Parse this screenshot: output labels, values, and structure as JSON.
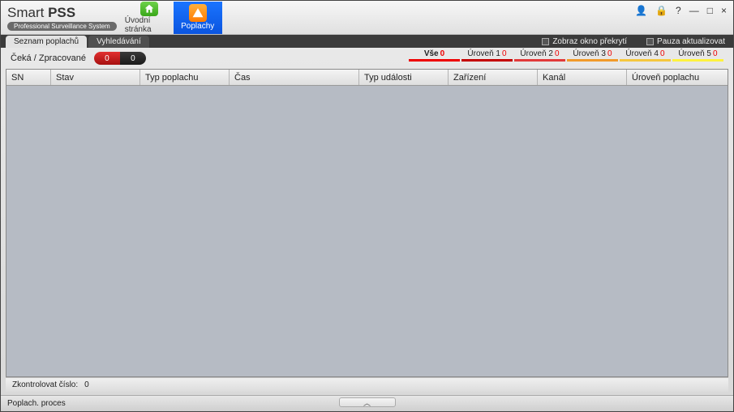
{
  "brand": {
    "name_light": "Smart ",
    "name_bold": "PSS",
    "subtitle": "Professional Surveillance System"
  },
  "nav": {
    "home": "Úvodní stránka",
    "alarms": "Poplachy"
  },
  "window_ctrls": {
    "user": "👤",
    "lock": "🔒",
    "help": "?",
    "min": "—",
    "max": "□",
    "close": "×"
  },
  "options": {
    "overlay": "Zobraz okno překrytí",
    "pause": "Pauza aktualizovat"
  },
  "subtabs": {
    "list": "Seznam poplachů",
    "search": "Vyhledávání"
  },
  "toolbar": {
    "pending_label": "Čeká / Zpracované",
    "pill_left": "0",
    "pill_right": "0"
  },
  "levels": {
    "all": {
      "label": "Vše",
      "count": "0"
    },
    "l1": {
      "label": "Úroveň 1",
      "count": "0"
    },
    "l2": {
      "label": "Úroveň 2",
      "count": "0"
    },
    "l3": {
      "label": "Úroveň 3",
      "count": "0"
    },
    "l4": {
      "label": "Úroveň 4",
      "count": "0"
    },
    "l5": {
      "label": "Úroveň 5",
      "count": "0"
    }
  },
  "columns": {
    "sn": "SN",
    "stav": "Stav",
    "typ_poplachu": "Typ poplachu",
    "cas": "Čas",
    "typ_udalosti": "Typ události",
    "zarizeni": "Zařízení",
    "kanal": "Kanál",
    "uroven": "Úroveň poplachu"
  },
  "footer": {
    "check_label": "Zkontrolovat číslo:",
    "check_value": "0"
  },
  "status": {
    "text": "Poplach. proces",
    "expand_glyph": "︿"
  }
}
